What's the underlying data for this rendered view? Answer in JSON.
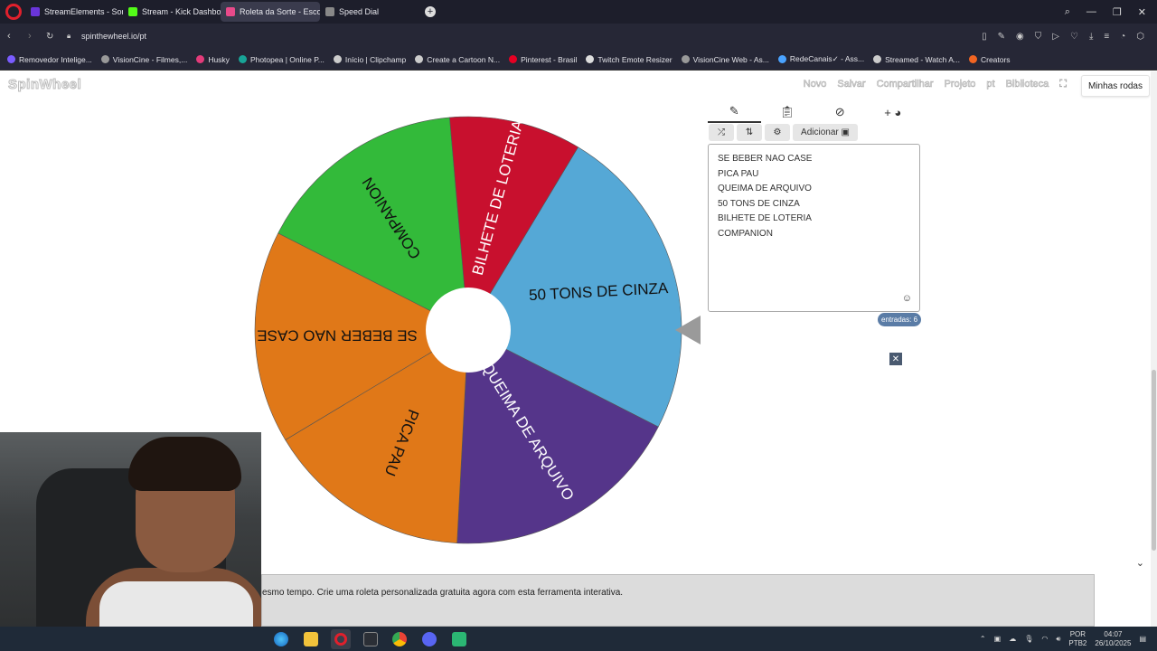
{
  "browser": {
    "tabs": [
      {
        "label": "StreamElements - Songre",
        "color": "#6a35d9"
      },
      {
        "label": "Stream - Kick Dashboard",
        "color": "#53fc18"
      },
      {
        "label": "Roleta da Sorte - Escolha",
        "color": "#e84a8a"
      },
      {
        "label": "Speed Dial",
        "color": "#888888"
      }
    ],
    "url": "spinthewheel.io/pt",
    "bookmarks": [
      {
        "label": "Removedor Intelige...",
        "color": "#7a5cff"
      },
      {
        "label": "VisionCine - Filmes,...",
        "color": "#999999"
      },
      {
        "label": "Husky",
        "color": "#e33b7a"
      },
      {
        "label": "Photopea | Online P...",
        "color": "#18a497"
      },
      {
        "label": "Início | Clipchamp",
        "color": "#cccccc"
      },
      {
        "label": "Create a Cartoon N...",
        "color": "#cccccc"
      },
      {
        "label": "Pinterest - Brasil",
        "color": "#e60023"
      },
      {
        "label": "Twitch Emote Resizer",
        "color": "#dddddd"
      },
      {
        "label": "VisionCine Web - As...",
        "color": "#999999"
      },
      {
        "label": "RedeCanais✓ - Ass...",
        "color": "#4aa3ff"
      },
      {
        "label": "Streamed - Watch A...",
        "color": "#cccccc"
      },
      {
        "label": "Creators",
        "color": "#f26522"
      }
    ]
  },
  "site": {
    "logo": "SpinWheel",
    "nav": {
      "novo": "Novo",
      "salvar": "Salvar",
      "compartilhar": "Compartilhar",
      "projeto": "Projeto",
      "lang": "pt",
      "biblioteca": "Biblioteca",
      "minhas_rodas": "Minhas rodas"
    }
  },
  "wheel": {
    "segments": [
      {
        "label": "50 TONS DE CINZA",
        "color": "#55a8d6"
      },
      {
        "label": "QUEIMA DE ARQUIVO",
        "color": "#55358a"
      },
      {
        "label": "PICA PAU",
        "color": "#e07818"
      },
      {
        "label": "SE BEBER NAO CASE",
        "color": "#e07818"
      },
      {
        "label": "COMPANION",
        "color": "#33ba3a"
      },
      {
        "label": "BILHETE DE LOTERIA",
        "color": "#c8102e"
      }
    ]
  },
  "editor": {
    "add_label": "Adicionar",
    "entries": [
      "SE BEBER NAO CASE",
      "PICA PAU",
      "QUEIMA DE ARQUIVO",
      "50 TONS DE CINZA",
      "BILHETE DE LOTERIA",
      "COMPANION"
    ],
    "count_label": "entradas: 6"
  },
  "footer": {
    "text": "esmo tempo. Crie uma roleta personalizada gratuita agora com esta ferramenta interativa."
  },
  "taskbar": {
    "lang_top": "POR",
    "lang_bottom": "PTB2",
    "time": "04:07",
    "date": "26/10/2025"
  }
}
